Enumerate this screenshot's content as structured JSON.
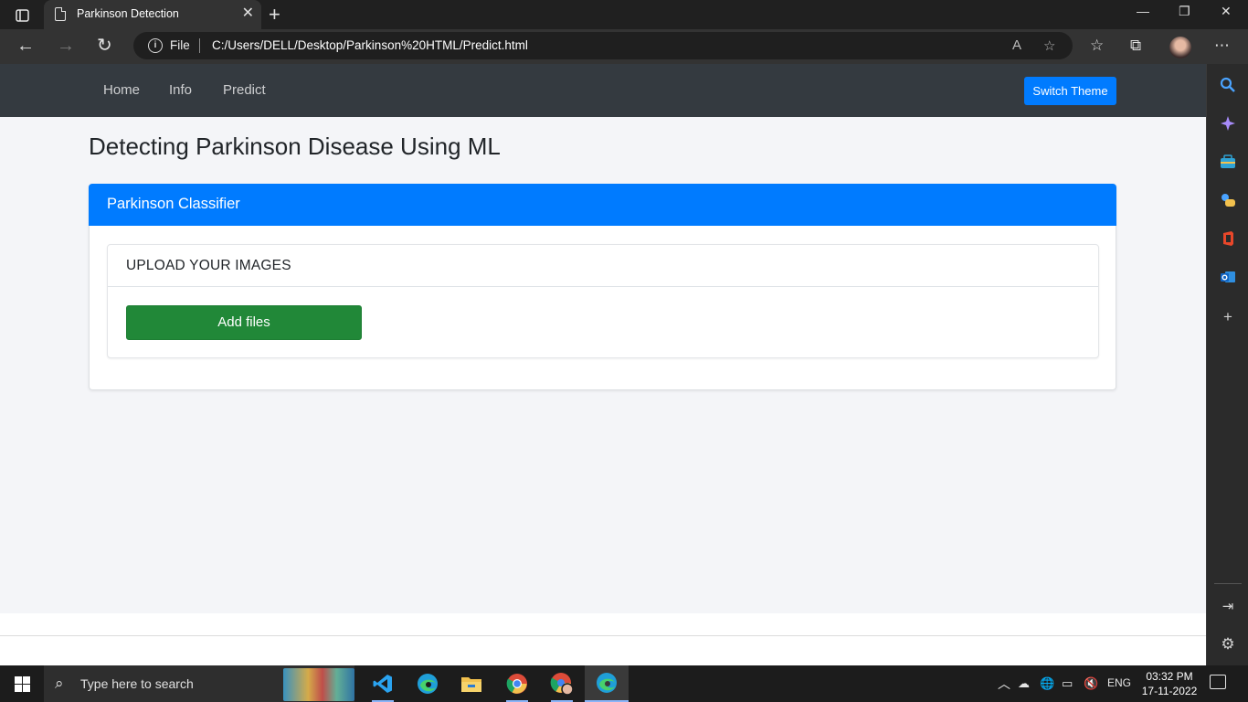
{
  "browser": {
    "tab_title": "Parkinson Detection",
    "tab_close": "✕",
    "new_tab": "+",
    "window_controls": {
      "minimize": "—",
      "restore": "❐",
      "close": "✕"
    },
    "address": {
      "protocol_label": "File",
      "url": "C:/Users/DELL/Desktop/Parkinson%20HTML/Predict.html"
    },
    "icons": {
      "back": "←",
      "forward": "→",
      "refresh": "↻",
      "read_aloud": "A",
      "add_favorite": "☆",
      "favorites": "☆",
      "collections": "⧉",
      "more": "⋯"
    }
  },
  "sidebar": {
    "items": [
      {
        "name": "search",
        "glyph": "🔍"
      },
      {
        "name": "discover",
        "glyph": "✦"
      },
      {
        "name": "tools",
        "glyph": "🧰"
      },
      {
        "name": "games",
        "glyph": "♟"
      },
      {
        "name": "office",
        "glyph": "◧"
      },
      {
        "name": "outlook",
        "glyph": "✉"
      },
      {
        "name": "add",
        "glyph": "+"
      }
    ],
    "bottom": {
      "hide_sidebar": "⇥",
      "settings": "⚙"
    }
  },
  "site": {
    "nav": {
      "home": "Home",
      "info": "Info",
      "predict": "Predict"
    },
    "switch_theme": "Switch Theme",
    "page_title": "Detecting Parkinson Disease Using ML",
    "card_header": "Parkinson Classifier",
    "upload_heading": "UPLOAD YOUR IMAGES",
    "add_files": "Add files"
  },
  "taskbar": {
    "search_placeholder": "Type here to search",
    "language": "ENG",
    "time": "03:32 PM",
    "date": "17-11-2022",
    "apps": [
      "vscode",
      "edge",
      "file-explorer",
      "chrome",
      "chrome-profile",
      "edge-active"
    ]
  },
  "colors": {
    "navbar": "#343a40",
    "primary": "#007bff",
    "success": "#218838",
    "page_bg": "#f4f5f8"
  }
}
